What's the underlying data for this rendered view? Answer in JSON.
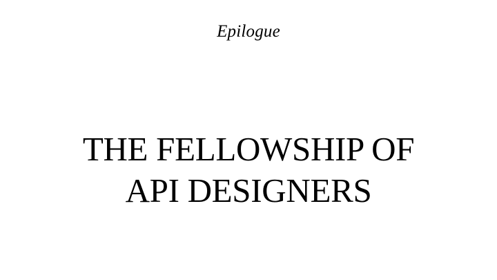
{
  "page": {
    "section_label": "Epilogue",
    "title_lines": [
      "THE FELLOWSHIP OF",
      "API DESIGNERS"
    ]
  },
  "colors": {
    "background": "#ffffff",
    "text": "#000000"
  }
}
